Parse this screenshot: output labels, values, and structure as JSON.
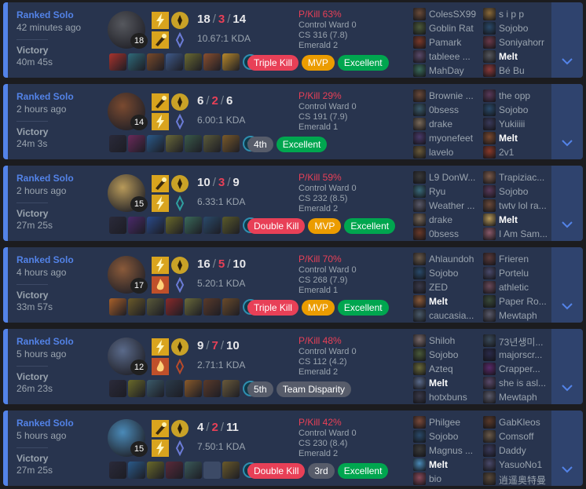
{
  "colors": {
    "victory_bg": "#28344e",
    "victory_accent": "#5383e8",
    "expand_bg": "#2f436e",
    "death_red": "#e84057",
    "mvp_gold": "#eb9c00",
    "excellent_green": "#00a64f",
    "neutral_badge": "#575c6a"
  },
  "icons": {
    "expand": "chevron-down-icon",
    "spells": [
      "flash-icon",
      "smite-icon",
      "ignite-icon",
      "teleport-icon",
      "exhaust-icon"
    ]
  },
  "matches": [
    {
      "queue": "Ranked Solo",
      "time_ago": "42 minutes ago",
      "result": "Victory",
      "duration": "40m 45s",
      "champion_color": "#56585e",
      "champion_level": "18",
      "spell_icons": [
        "flash",
        "smite"
      ],
      "rune_colors": [
        "#c9a227",
        "#6b7bd6"
      ],
      "kills": "18",
      "deaths": "3",
      "assists": "14",
      "kda_ratio": "10.67:1 KDA",
      "item_colors": [
        "#a8332d",
        "#2f6a7a",
        "#7a4a2a",
        "#3f5a8a",
        "#6a6a32",
        "#8a4f2f",
        "#b8892b"
      ],
      "ward_color": "#2f8fb0",
      "badges": [
        {
          "label": "Triple Kill",
          "tone": "red"
        },
        {
          "label": "MVP",
          "tone": "gold"
        },
        {
          "label": "Excellent",
          "tone": "green"
        }
      ],
      "p_kill": "P/Kill 63%",
      "control_ward": "Control Ward 0",
      "cs": "CS 316 (7.8)",
      "rank": "Emerald 2",
      "team1": [
        {
          "name": "ColesSX99",
          "color": "#6a4c3a",
          "me": false
        },
        {
          "name": "Goblin Rat",
          "color": "#4c5a3a",
          "me": false
        },
        {
          "name": "Pamark",
          "color": "#7a3a2a",
          "me": false
        },
        {
          "name": "tableee ...",
          "color": "#5a4a6a",
          "me": false
        },
        {
          "name": "MahDay",
          "color": "#3a6a5a",
          "me": false
        }
      ],
      "team2": [
        {
          "name": "s i p p",
          "color": "#8a6a3a",
          "me": false
        },
        {
          "name": "Sojobo",
          "color": "#2a4a6a",
          "me": false
        },
        {
          "name": "Soniyahorr",
          "color": "#6a3a4a",
          "me": false
        },
        {
          "name": "Melt",
          "color": "#56585e",
          "me": true
        },
        {
          "name": "Bé Bu",
          "color": "#8a3a3a",
          "me": false
        }
      ]
    },
    {
      "queue": "Ranked Solo",
      "time_ago": "2 hours ago",
      "result": "Victory",
      "duration": "24m 3s",
      "champion_color": "#7a4a30",
      "champion_level": "14",
      "spell_icons": [
        "smite",
        "flash"
      ],
      "rune_colors": [
        "#c9a227",
        "#6b7bd6"
      ],
      "kills": "6",
      "deaths": "2",
      "assists": "6",
      "kda_ratio": "6.00:1 KDA",
      "item_colors": [
        "#2a2a3a",
        "#6a2a5a",
        "#2a5a8a",
        "#6a6a3a",
        "#3a5a4a",
        "#5a5a3a",
        "#7a5a2a"
      ],
      "ward_color": "#2f8fb0",
      "badges": [
        {
          "label": "4th",
          "tone": "gray"
        },
        {
          "label": "Excellent",
          "tone": "green"
        }
      ],
      "p_kill": "P/Kill 29%",
      "control_ward": "Control Ward 0",
      "cs": "CS 191 (7.9)",
      "rank": "Emerald 1",
      "team1": [
        {
          "name": "Brownie ...",
          "color": "#6a4a3a",
          "me": false
        },
        {
          "name": "0bsess",
          "color": "#3a5a6a",
          "me": false
        },
        {
          "name": "drake",
          "color": "#7a6a5a",
          "me": false
        },
        {
          "name": "myonefeet",
          "color": "#4a3a6a",
          "me": false
        },
        {
          "name": "lavelo",
          "color": "#6a5a3a",
          "me": false
        }
      ],
      "team2": [
        {
          "name": "the opp",
          "color": "#5a3a5a",
          "me": false
        },
        {
          "name": "Sojobo",
          "color": "#2a4a6a",
          "me": false
        },
        {
          "name": "Yukiiiii",
          "color": "#3a3a5a",
          "me": false
        },
        {
          "name": "Melt",
          "color": "#7a4a30",
          "me": true
        },
        {
          "name": "2v1",
          "color": "#8a3a2a",
          "me": false
        }
      ]
    },
    {
      "queue": "Ranked Solo",
      "time_ago": "2 hours ago",
      "result": "Victory",
      "duration": "27m 25s",
      "champion_color": "#b89a5a",
      "champion_level": "15",
      "spell_icons": [
        "smite",
        "flash"
      ],
      "rune_colors": [
        "#c9a227",
        "#2fa0a0"
      ],
      "kills": "10",
      "deaths": "3",
      "assists": "9",
      "kda_ratio": "6.33:1 KDA",
      "item_colors": [
        "#2a2a3a",
        "#4a2a6a",
        "#2a4a8a",
        "#6a6a2a",
        "#3a6a5a",
        "#2a4a6a",
        "#5a5a2a"
      ],
      "ward_color": "#2f8fb0",
      "badges": [
        {
          "label": "Double Kill",
          "tone": "red"
        },
        {
          "label": "MVP",
          "tone": "gold"
        },
        {
          "label": "Excellent",
          "tone": "green"
        }
      ],
      "p_kill": "P/Kill 59%",
      "control_ward": "Control Ward 0",
      "cs": "CS 232 (8.5)",
      "rank": "Emerald 2",
      "team1": [
        {
          "name": "L9 DonW...",
          "color": "#3a3a3a",
          "me": false
        },
        {
          "name": "Ryu",
          "color": "#3a6a7a",
          "me": false
        },
        {
          "name": "Weather ...",
          "color": "#5a5a6a",
          "me": false
        },
        {
          "name": "drake",
          "color": "#7a6a5a",
          "me": false
        },
        {
          "name": "0bsess",
          "color": "#6a3a2a",
          "me": false
        }
      ],
      "team2": [
        {
          "name": "Trapiziac...",
          "color": "#7a5a4a",
          "me": false
        },
        {
          "name": "Sojobo",
          "color": "#5a3a5a",
          "me": false
        },
        {
          "name": "twtv lol ra...",
          "color": "#6a4a3a",
          "me": false
        },
        {
          "name": "Melt",
          "color": "#b89a5a",
          "me": true
        },
        {
          "name": "I Am Sam...",
          "color": "#8a5a6a",
          "me": false
        }
      ]
    },
    {
      "queue": "Ranked Solo",
      "time_ago": "4 hours ago",
      "result": "Victory",
      "duration": "33m 57s",
      "champion_color": "#8a5a3a",
      "champion_level": "17",
      "spell_icons": [
        "flash",
        "ignite"
      ],
      "rune_colors": [
        "#c9a227",
        "#6b7bd6"
      ],
      "kills": "16",
      "deaths": "5",
      "assists": "10",
      "kda_ratio": "5.20:1 KDA",
      "item_colors": [
        "#a8602a",
        "#6a5a2a",
        "#5a5a3a",
        "#8a2a2a",
        "#6a6a3a",
        "#5a3a2a",
        "#6a4a2a"
      ],
      "ward_color": "#2f8fb0",
      "badges": [
        {
          "label": "Triple Kill",
          "tone": "red"
        },
        {
          "label": "MVP",
          "tone": "gold"
        },
        {
          "label": "Excellent",
          "tone": "green"
        }
      ],
      "p_kill": "P/Kill 70%",
      "control_ward": "Control Ward 0",
      "cs": "CS 268 (7.9)",
      "rank": "Emerald 1",
      "team1": [
        {
          "name": "Ahlaundoh",
          "color": "#6a5a4a",
          "me": false
        },
        {
          "name": "Sojobo",
          "color": "#2a4a6a",
          "me": false
        },
        {
          "name": "ZED",
          "color": "#3a3a4a",
          "me": false
        },
        {
          "name": "Melt",
          "color": "#8a5a3a",
          "me": true
        },
        {
          "name": "caucasia...",
          "color": "#4a5a6a",
          "me": false
        }
      ],
      "team2": [
        {
          "name": "Frieren",
          "color": "#5a3a3a",
          "me": false
        },
        {
          "name": "Portelu",
          "color": "#4a4a6a",
          "me": false
        },
        {
          "name": "athletic",
          "color": "#6a4a5a",
          "me": false
        },
        {
          "name": "Paper Ro...",
          "color": "#3a4a3a",
          "me": false
        },
        {
          "name": "Mewtaph",
          "color": "#5a5a6a",
          "me": false
        }
      ]
    },
    {
      "queue": "Ranked Solo",
      "time_ago": "5 hours ago",
      "result": "Victory",
      "duration": "26m 23s",
      "champion_color": "#5a6a8a",
      "champion_level": "12",
      "spell_icons": [
        "flash",
        "ignite"
      ],
      "rune_colors": [
        "#c9a227",
        "#b84a2a"
      ],
      "kills": "9",
      "deaths": "7",
      "assists": "10",
      "kda_ratio": "2.71:1 KDA",
      "item_colors": [
        "#2a2a3a",
        "#6a6a2a",
        "#3a5a6a",
        "#2a3a4a",
        "#8a5a2a",
        "#5a3a2a",
        "#6a5a3a"
      ],
      "ward_color": "#2f8fb0",
      "badges": [
        {
          "label": "5th",
          "tone": "gray"
        },
        {
          "label": "Team Disparity",
          "tone": "gray"
        }
      ],
      "p_kill": "P/Kill 48%",
      "control_ward": "Control Ward 0",
      "cs": "CS 112 (4.2)",
      "rank": "Emerald 2",
      "team1": [
        {
          "name": "Shiloh",
          "color": "#7a6a6a",
          "me": false
        },
        {
          "name": "Sojobo",
          "color": "#4a5a3a",
          "me": false
        },
        {
          "name": "Azteq",
          "color": "#6a6a3a",
          "me": false
        },
        {
          "name": "Melt",
          "color": "#5a6a8a",
          "me": true
        },
        {
          "name": "hotxbuns",
          "color": "#3a3a4a",
          "me": false
        }
      ],
      "team2": [
        {
          "name": "73년생미...",
          "color": "#3a4a5a",
          "me": false
        },
        {
          "name": "majorscr...",
          "color": "#2a2a4a",
          "me": false
        },
        {
          "name": "Crapper...",
          "color": "#5a2a6a",
          "me": false
        },
        {
          "name": "she is asl...",
          "color": "#5a4a6a",
          "me": false
        },
        {
          "name": "Mewtaph",
          "color": "#5a5a6a",
          "me": false
        }
      ]
    },
    {
      "queue": "Ranked Solo",
      "time_ago": "5 hours ago",
      "result": "Victory",
      "duration": "27m 25s",
      "champion_color": "#4a8ab8",
      "champion_level": "15",
      "spell_icons": [
        "smite",
        "flash"
      ],
      "rune_colors": [
        "#c9a227",
        "#6b7bd6"
      ],
      "kills": "4",
      "deaths": "2",
      "assists": "11",
      "kda_ratio": "7.50:1 KDA",
      "item_colors": [
        "#2a2a3a",
        "#2a5a8a",
        "#6a6a2a",
        "#5a2a3a",
        "#3a5a5a",
        "empty",
        "#6a5a2a"
      ],
      "ward_color": "#2f8fb0",
      "badges": [
        {
          "label": "Double Kill",
          "tone": "red"
        },
        {
          "label": "3rd",
          "tone": "gray"
        },
        {
          "label": "Excellent",
          "tone": "green"
        }
      ],
      "p_kill": "P/Kill 42%",
      "control_ward": "Control Ward 0",
      "cs": "CS 230 (8.4)",
      "rank": "Emerald 2",
      "team1": [
        {
          "name": "Philgee",
          "color": "#7a4a3a",
          "me": false
        },
        {
          "name": "Sojobo",
          "color": "#2a4a6a",
          "me": false
        },
        {
          "name": "Magnus ...",
          "color": "#3a3a3a",
          "me": false
        },
        {
          "name": "Melt",
          "color": "#4a8ab8",
          "me": true
        },
        {
          "name": "bio",
          "color": "#8a4a5a",
          "me": false
        }
      ],
      "team2": [
        {
          "name": "GabKleos",
          "color": "#5a3a2a",
          "me": false
        },
        {
          "name": "Comsoff",
          "color": "#6a5a4a",
          "me": false
        },
        {
          "name": "Daddy",
          "color": "#3a3a5a",
          "me": false
        },
        {
          "name": "YasuoNo1",
          "color": "#4a4a6a",
          "me": false
        },
        {
          "name": "逍遥奥特曼",
          "color": "#5a4a3a",
          "me": false
        }
      ]
    }
  ]
}
